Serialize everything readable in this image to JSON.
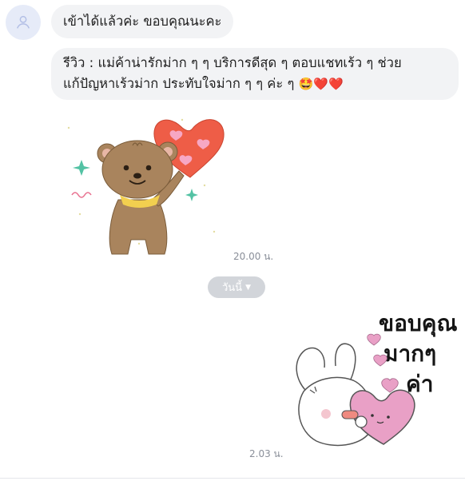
{
  "chat": {
    "messages": [
      {
        "text": "เข้าได้แล้วค่ะ ขอบคุณนะคะ"
      },
      {
        "line1": "รีวิว : แม่ค้าน่ารักม่าก ๆ ๆ บริการดีสุด ๆ ตอบแชทเร้ว ๆ ช่วย",
        "line2": "แก้ปัญหาเร้วม่าก ประทับใจม่าก ๆ ๆ ค่ะ ๆ",
        "emoji1": "🤩",
        "emoji2": "❤️",
        "emoji3": "❤️"
      }
    ],
    "sticker1_time": "20.00 น.",
    "date_separator": "วันนี้",
    "sticker2_text": [
      "ขอบคุณ",
      "มากๆ",
      "ค่า"
    ],
    "sticker2_time": "2.03 น."
  },
  "icons": {
    "avatar": "user-icon",
    "date_caret": "caret-down-icon"
  },
  "colors": {
    "bubble_bg": "#f2f3f5",
    "avatar_bg": "#e6ebf8",
    "pill_bg": "#d2d5da",
    "time_text": "#8a8f99"
  }
}
